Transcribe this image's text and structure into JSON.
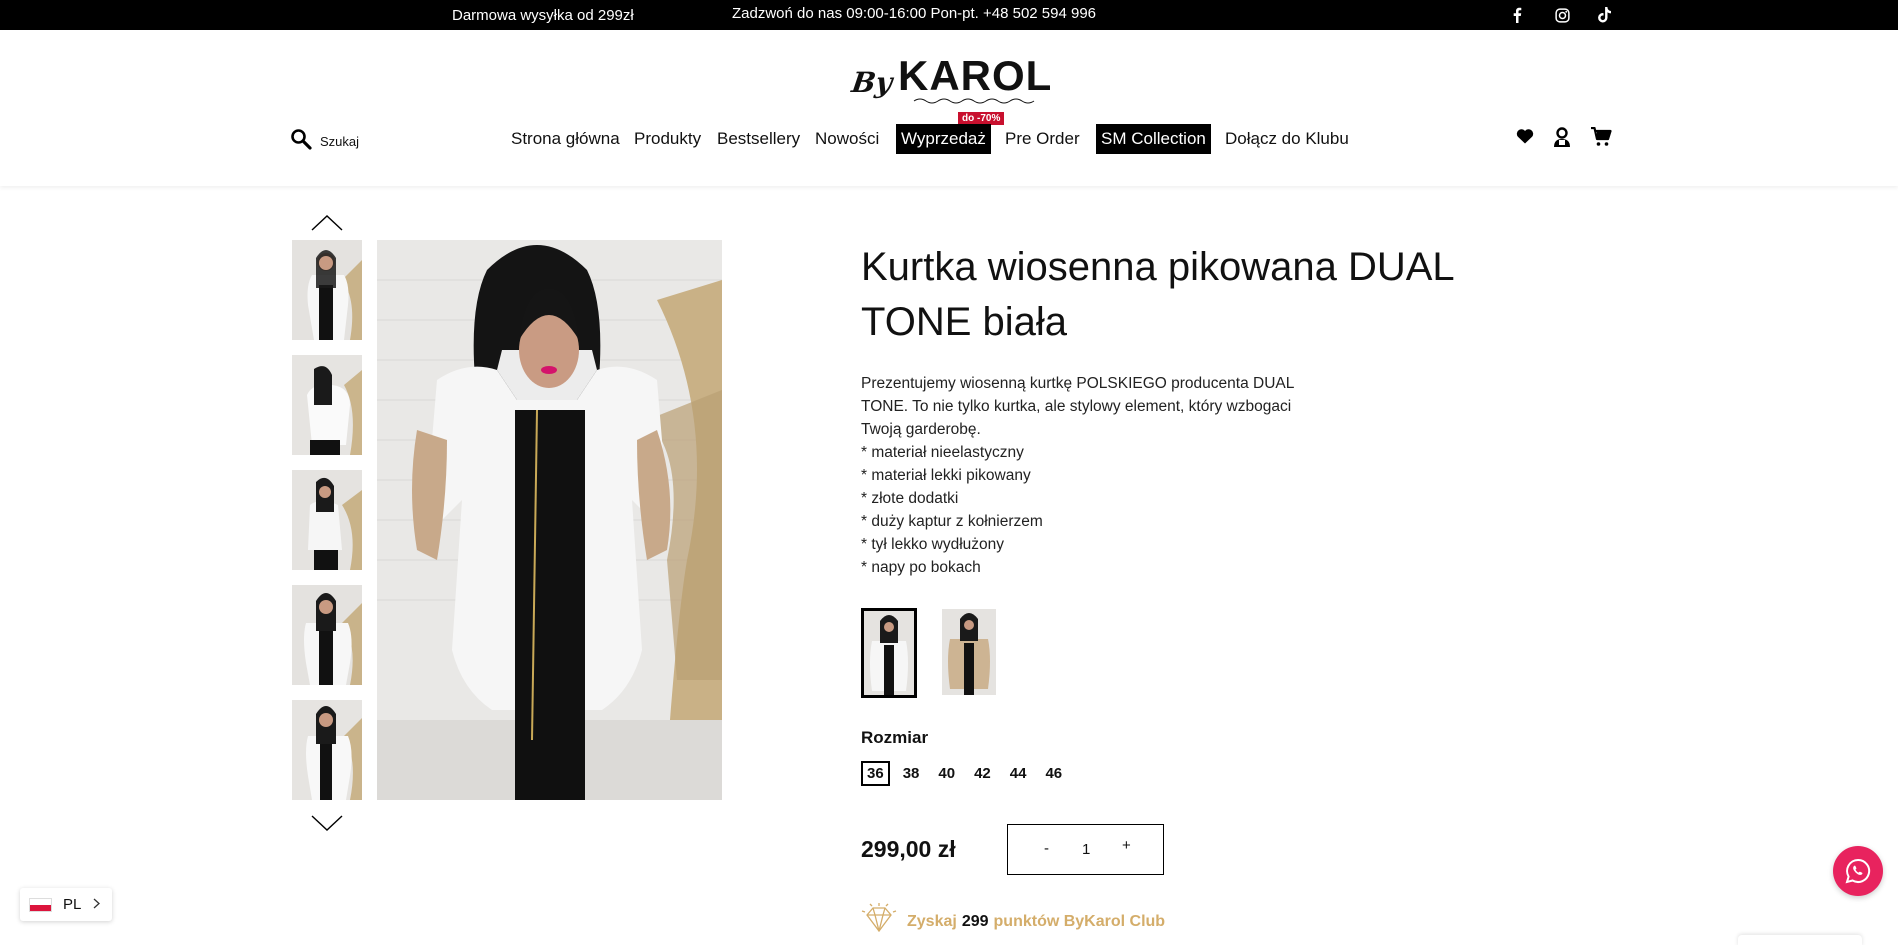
{
  "topbar": {
    "shipping": "Darmowa wysyłka od 299zł",
    "contact": "Zadzwoń do nas 09:00-16:00 Pon-pt. +48 502 594 996",
    "social": [
      "facebook-icon",
      "instagram-icon",
      "tiktok-icon"
    ]
  },
  "logo": {
    "by": "By",
    "karol": "KAROL"
  },
  "search": {
    "placeholder": "Szukaj"
  },
  "nav": {
    "home": "Strona główna",
    "products": "Produkty",
    "bestsellers": "Bestsellery",
    "news": "Nowości",
    "sale": "Wyprzedaż",
    "sale_badge": "do -70%",
    "preorder": "Pre Order",
    "sm": "SM Collection",
    "club": "Dołącz do Klubu"
  },
  "header_icons": [
    "heart-icon",
    "account-icon",
    "cart-icon"
  ],
  "product": {
    "title": "Kurtka wiosenna pikowana DUAL TONE biała",
    "description": [
      "Prezentujemy wiosenną kurtkę POLSKIEGO producenta DUAL TONE. To nie tylko kurtka, ale stylowy element, który wzbogaci Twoją garderobę.",
      "* materiał nieelastyczny",
      "* materiał lekki pikowany",
      "* złote dodatki",
      "* duży kaptur z kołnierzem",
      "* tył lekko wydłużony",
      "* napy po bokach"
    ],
    "size_label": "Rozmiar",
    "sizes": [
      "36",
      "38",
      "40",
      "42",
      "44",
      "46"
    ],
    "selected_size": "36",
    "price": "299,00 zł",
    "qty_minus": "-",
    "qty_value": "1",
    "qty_plus": "+"
  },
  "club": {
    "prefix": "Zyskaj",
    "points": "299",
    "suffix": "punktów ByKarol Club"
  },
  "language": {
    "code": "PL"
  },
  "colors": {
    "accent": "#c8102e",
    "gold": "#d4ad6a",
    "whatsapp": "#e8235e"
  }
}
